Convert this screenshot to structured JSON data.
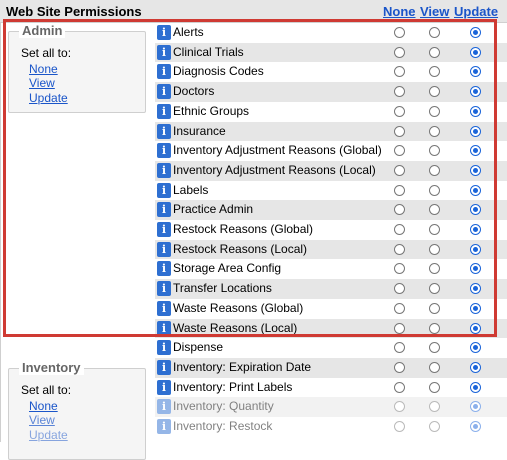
{
  "header": {
    "title": "Web Site Permissions",
    "none": "None",
    "view": "View",
    "update": "Update"
  },
  "groups": [
    {
      "legend": "Admin",
      "setall": "Set all to:",
      "none": "None",
      "view": "View",
      "update": "Update"
    },
    {
      "legend": "Inventory",
      "setall": "Set all to:",
      "none": "None",
      "view": "View",
      "update": "Update"
    }
  ],
  "rows": [
    {
      "label": "Alerts",
      "selected": "update"
    },
    {
      "label": "Clinical Trials",
      "selected": "update"
    },
    {
      "label": "Diagnosis Codes",
      "selected": "update"
    },
    {
      "label": "Doctors",
      "selected": "update"
    },
    {
      "label": "Ethnic Groups",
      "selected": "update"
    },
    {
      "label": "Insurance",
      "selected": "update"
    },
    {
      "label": "Inventory Adjustment Reasons (Global)",
      "selected": "update"
    },
    {
      "label": "Inventory Adjustment Reasons (Local)",
      "selected": "update"
    },
    {
      "label": "Labels",
      "selected": "update"
    },
    {
      "label": "Practice Admin",
      "selected": "update"
    },
    {
      "label": "Restock Reasons (Global)",
      "selected": "update"
    },
    {
      "label": "Restock Reasons (Local)",
      "selected": "update"
    },
    {
      "label": "Storage Area Config",
      "selected": "update"
    },
    {
      "label": "Transfer Locations",
      "selected": "update"
    },
    {
      "label": "Waste Reasons (Global)",
      "selected": "update"
    },
    {
      "label": "Waste Reasons (Local)",
      "selected": "update"
    },
    {
      "label": "Dispense",
      "selected": "update"
    },
    {
      "label": "Inventory: Expiration Date",
      "selected": "update"
    },
    {
      "label": "Inventory: Print Labels",
      "selected": "update"
    },
    {
      "label": "Inventory: Quantity",
      "selected": "update"
    },
    {
      "label": "Inventory: Restock",
      "selected": "update"
    }
  ],
  "info_icon": "info-icon",
  "colors": {
    "highlight": "#cf3a33",
    "link": "#1a55c9",
    "radio_selected": "#1a64d9",
    "info_icon": "#2e6fd1",
    "row_alt": "#e6e6e6"
  }
}
